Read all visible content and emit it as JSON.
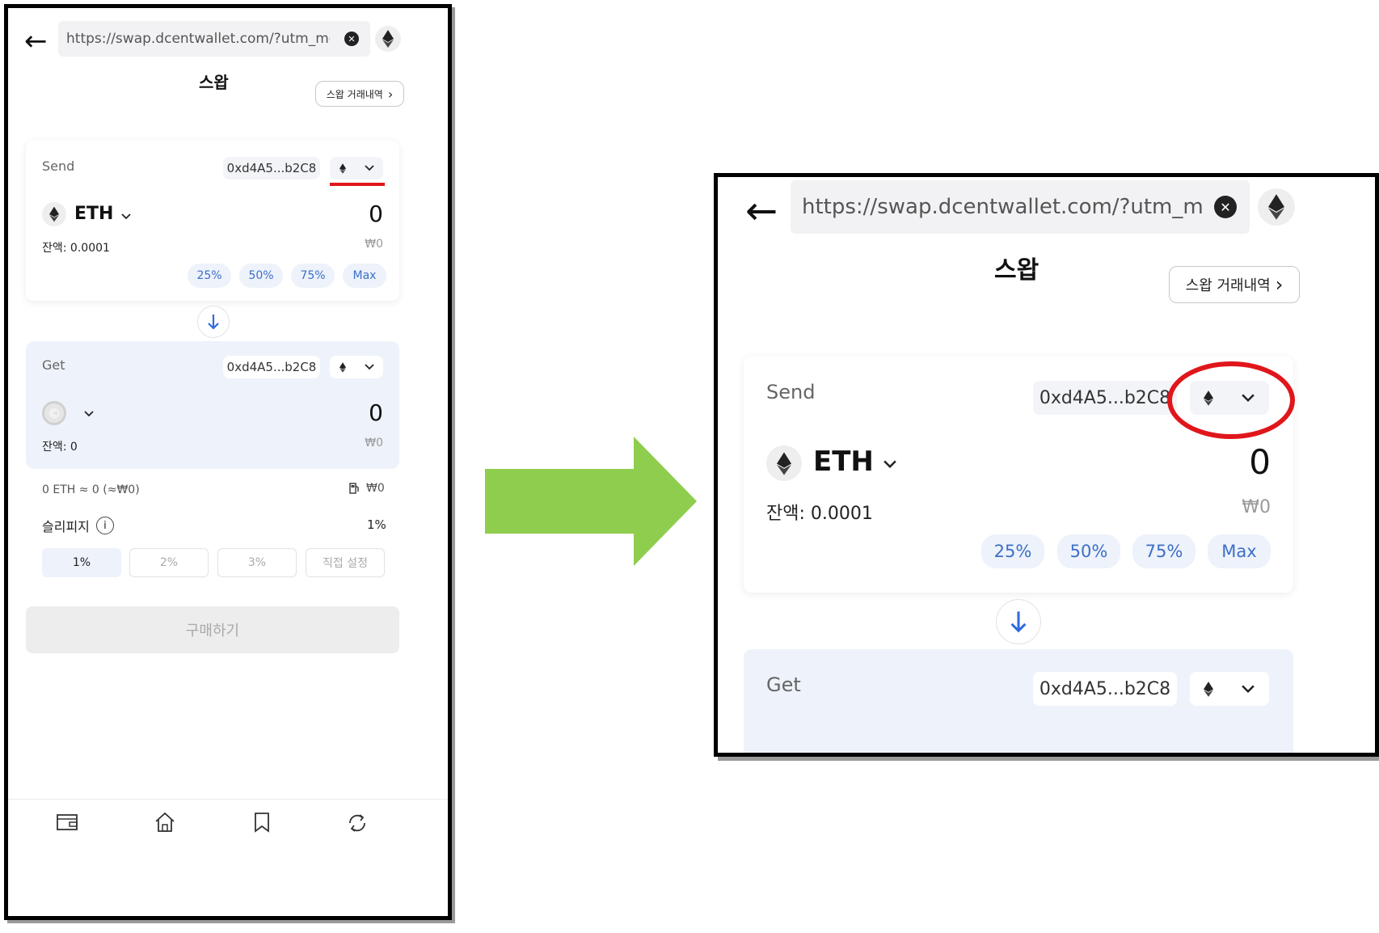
{
  "browser": {
    "back_icon": "←",
    "url": "https://swap.dcentwallet.com/?utm_medium",
    "clear_icon": "✕",
    "site_icon": "ethereum-logo"
  },
  "header": {
    "title": "스왑",
    "history_label": "스왑 거래내역",
    "history_chevron": "›"
  },
  "send": {
    "label": "Send",
    "address": "0xd4A5...b2C8",
    "token": "ETH",
    "amount": "0",
    "balance": "잔액: 0.0001",
    "krw": "₩0",
    "percent_buttons": [
      "25%",
      "50%",
      "75%",
      "Max"
    ]
  },
  "get": {
    "label": "Get",
    "address": "0xd4A5...b2C8",
    "amount": "0",
    "balance": "잔액: 0",
    "krw": "₩0"
  },
  "fee": {
    "text": "0 ETH ≈ 0 (≈₩0)",
    "gas_krw": "₩0"
  },
  "slippage": {
    "label": "슬리피지",
    "value": "1%",
    "options": [
      "1%",
      "2%",
      "3%",
      "직접 설정"
    ],
    "selected": "1%"
  },
  "buy_button": "구매하기",
  "bottom_nav": [
    "wallet-icon",
    "home-icon",
    "bookmark-icon",
    "swap-icon"
  ],
  "colors": {
    "accent_blue": "#3d6fc6",
    "highlight_red": "#e0161b",
    "arrow_green": "#8fcd4e"
  }
}
